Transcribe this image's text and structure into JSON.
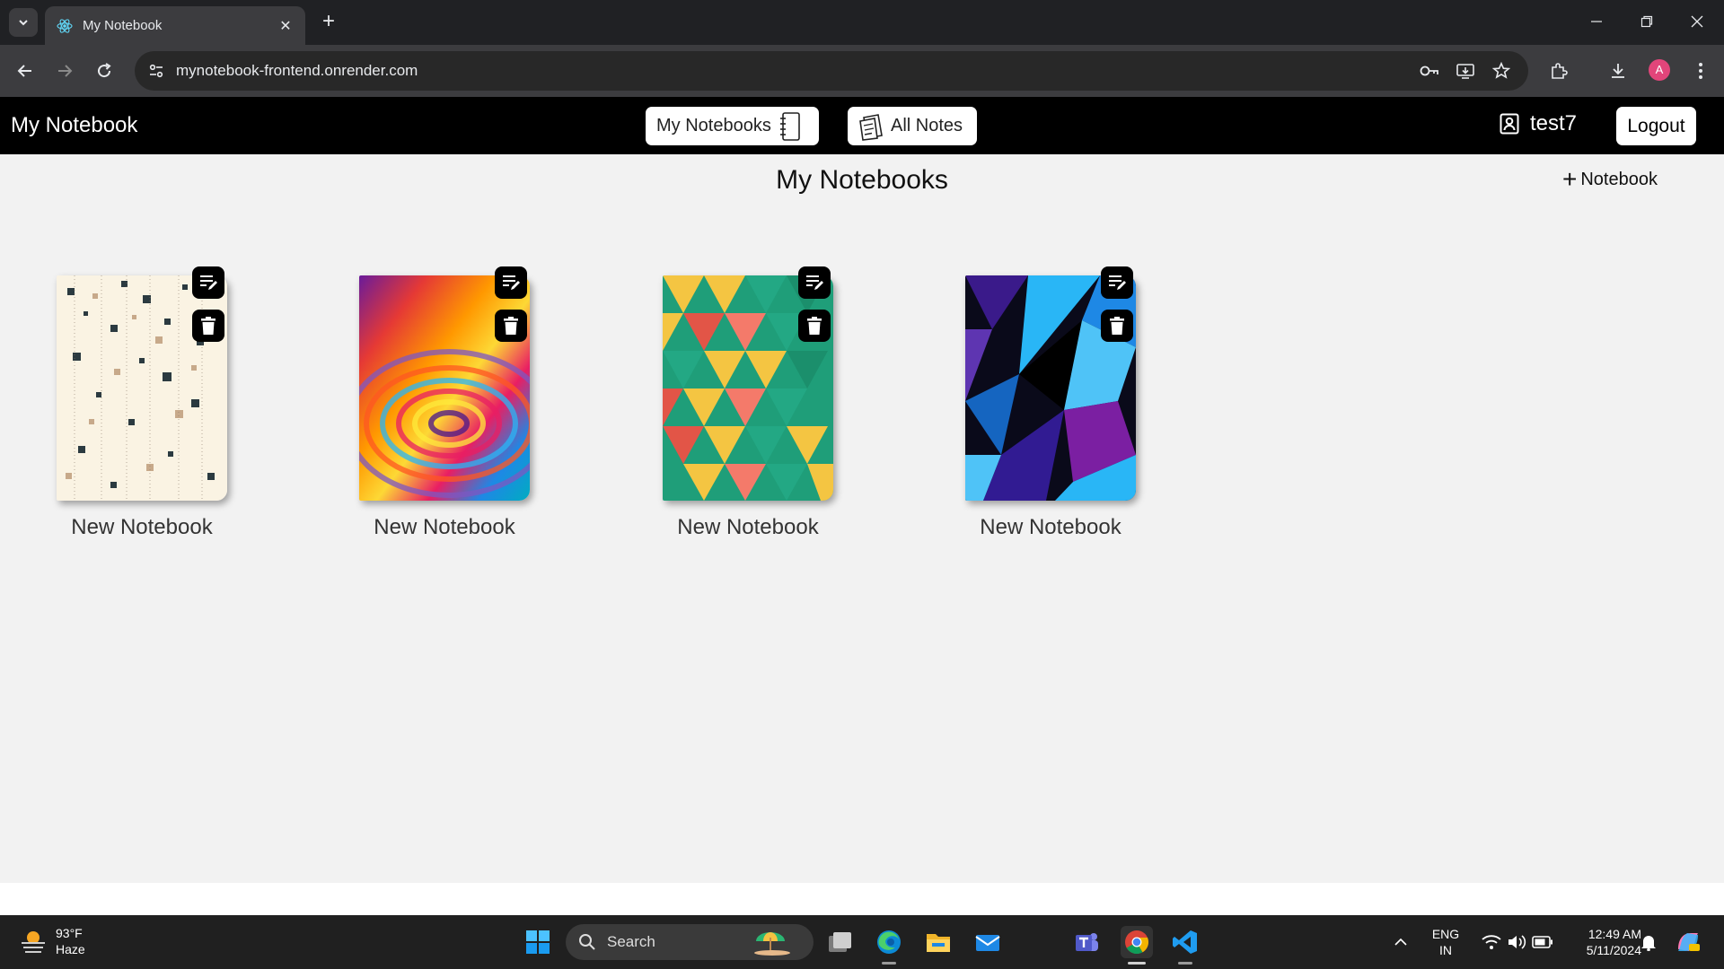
{
  "browser": {
    "tab_title": "My Notebook",
    "url": "mynotebook-frontend.onrender.com",
    "profile_initial": "A"
  },
  "app": {
    "brand": "My Notebook",
    "nav": {
      "my_notebooks_label": "My Notebooks",
      "all_notes_label": "All Notes"
    },
    "user": {
      "username": "test7"
    },
    "logout_label": "Logout"
  },
  "main": {
    "title": "My Notebooks",
    "add_notebook_plus": "+",
    "add_notebook_label": "Notebook",
    "notebooks": [
      {
        "name": "New Notebook",
        "cover": "scattered-squares"
      },
      {
        "name": "New Notebook",
        "cover": "rainbow-swirl"
      },
      {
        "name": "New Notebook",
        "cover": "triangle-pattern"
      },
      {
        "name": "New Notebook",
        "cover": "blue-polygon"
      }
    ]
  },
  "taskbar": {
    "weather_temp": "93°F",
    "weather_desc": "Haze",
    "search_label": "Search",
    "lang_line1": "ENG",
    "lang_line2": "IN",
    "time": "12:49 AM",
    "date": "5/11/2024"
  },
  "colors": {
    "app_nav_bg": "#000000",
    "page_bg": "#f2f2f2",
    "chrome_dark": "#202124",
    "chrome_toolbar": "#3c3c3f"
  }
}
